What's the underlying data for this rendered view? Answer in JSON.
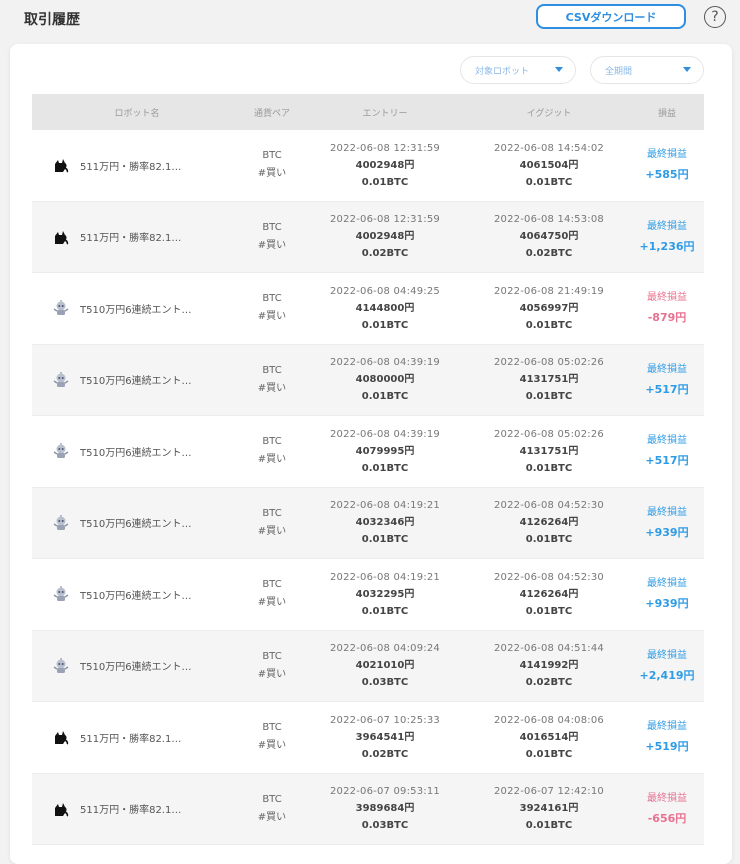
{
  "header": {
    "title": "取引履歴",
    "csv_button": "CSVダウンロード",
    "help": "?"
  },
  "filters": {
    "robot": "対象ロボット",
    "period": "全期間"
  },
  "table": {
    "columns": [
      "ロボット名",
      "通貨ペア",
      "エントリー",
      "イグジット",
      "損益"
    ],
    "rows": [
      {
        "icon": "cat-icon",
        "robot": "511万円・勝率82.1…",
        "pair": "BTC",
        "side": "#買い",
        "entry_time": "2022-06-08 12:31:59",
        "entry_price": "4002948円",
        "entry_qty": "0.01BTC",
        "exit_time": "2022-06-08 14:54:02",
        "exit_price": "4061504円",
        "exit_qty": "0.01BTC",
        "pl_label": "最終損益",
        "pl_value": "+585円",
        "pl_sign": "pos"
      },
      {
        "icon": "cat-icon",
        "robot": "511万円・勝率82.1…",
        "pair": "BTC",
        "side": "#買い",
        "entry_time": "2022-06-08 12:31:59",
        "entry_price": "4002948円",
        "entry_qty": "0.02BTC",
        "exit_time": "2022-06-08 14:53:08",
        "exit_price": "4064750円",
        "exit_qty": "0.02BTC",
        "pl_label": "最終損益",
        "pl_value": "+1,236円",
        "pl_sign": "pos"
      },
      {
        "icon": "robot-icon",
        "robot": "T510万円6連続エント…",
        "pair": "BTC",
        "side": "#買い",
        "entry_time": "2022-06-08 04:49:25",
        "entry_price": "4144800円",
        "entry_qty": "0.01BTC",
        "exit_time": "2022-06-08 21:49:19",
        "exit_price": "4056997円",
        "exit_qty": "0.01BTC",
        "pl_label": "最終損益",
        "pl_value": "-879円",
        "pl_sign": "neg"
      },
      {
        "icon": "robot-icon",
        "robot": "T510万円6連続エント…",
        "pair": "BTC",
        "side": "#買い",
        "entry_time": "2022-06-08 04:39:19",
        "entry_price": "4080000円",
        "entry_qty": "0.01BTC",
        "exit_time": "2022-06-08 05:02:26",
        "exit_price": "4131751円",
        "exit_qty": "0.01BTC",
        "pl_label": "最終損益",
        "pl_value": "+517円",
        "pl_sign": "pos"
      },
      {
        "icon": "robot-icon",
        "robot": "T510万円6連続エント…",
        "pair": "BTC",
        "side": "#買い",
        "entry_time": "2022-06-08 04:39:19",
        "entry_price": "4079995円",
        "entry_qty": "0.01BTC",
        "exit_time": "2022-06-08 05:02:26",
        "exit_price": "4131751円",
        "exit_qty": "0.01BTC",
        "pl_label": "最終損益",
        "pl_value": "+517円",
        "pl_sign": "pos"
      },
      {
        "icon": "robot-icon",
        "robot": "T510万円6連続エント…",
        "pair": "BTC",
        "side": "#買い",
        "entry_time": "2022-06-08 04:19:21",
        "entry_price": "4032346円",
        "entry_qty": "0.01BTC",
        "exit_time": "2022-06-08 04:52:30",
        "exit_price": "4126264円",
        "exit_qty": "0.01BTC",
        "pl_label": "最終損益",
        "pl_value": "+939円",
        "pl_sign": "pos"
      },
      {
        "icon": "robot-icon",
        "robot": "T510万円6連続エント…",
        "pair": "BTC",
        "side": "#買い",
        "entry_time": "2022-06-08 04:19:21",
        "entry_price": "4032295円",
        "entry_qty": "0.01BTC",
        "exit_time": "2022-06-08 04:52:30",
        "exit_price": "4126264円",
        "exit_qty": "0.01BTC",
        "pl_label": "最終損益",
        "pl_value": "+939円",
        "pl_sign": "pos"
      },
      {
        "icon": "robot-icon",
        "robot": "T510万円6連続エント…",
        "pair": "BTC",
        "side": "#買い",
        "entry_time": "2022-06-08 04:09:24",
        "entry_price": "4021010円",
        "entry_qty": "0.03BTC",
        "exit_time": "2022-06-08 04:51:44",
        "exit_price": "4141992円",
        "exit_qty": "0.02BTC",
        "pl_label": "最終損益",
        "pl_value": "+2,419円",
        "pl_sign": "pos"
      },
      {
        "icon": "cat-icon",
        "robot": "511万円・勝率82.1…",
        "pair": "BTC",
        "side": "#買い",
        "entry_time": "2022-06-07 10:25:33",
        "entry_price": "3964541円",
        "entry_qty": "0.02BTC",
        "exit_time": "2022-06-08 04:08:06",
        "exit_price": "4016514円",
        "exit_qty": "0.01BTC",
        "pl_label": "最終損益",
        "pl_value": "+519円",
        "pl_sign": "pos"
      },
      {
        "icon": "cat-icon",
        "robot": "511万円・勝率82.1…",
        "pair": "BTC",
        "side": "#買い",
        "entry_time": "2022-06-07 09:53:11",
        "entry_price": "3989684円",
        "entry_qty": "0.03BTC",
        "exit_time": "2022-06-07 12:42:10",
        "exit_price": "3924161円",
        "exit_qty": "0.01BTC",
        "pl_label": "最終損益",
        "pl_value": "-656円",
        "pl_sign": "neg"
      }
    ]
  },
  "colors": {
    "accent": "#2e8ee0",
    "profit": "#2e9be6",
    "loss": "#e8718f"
  }
}
